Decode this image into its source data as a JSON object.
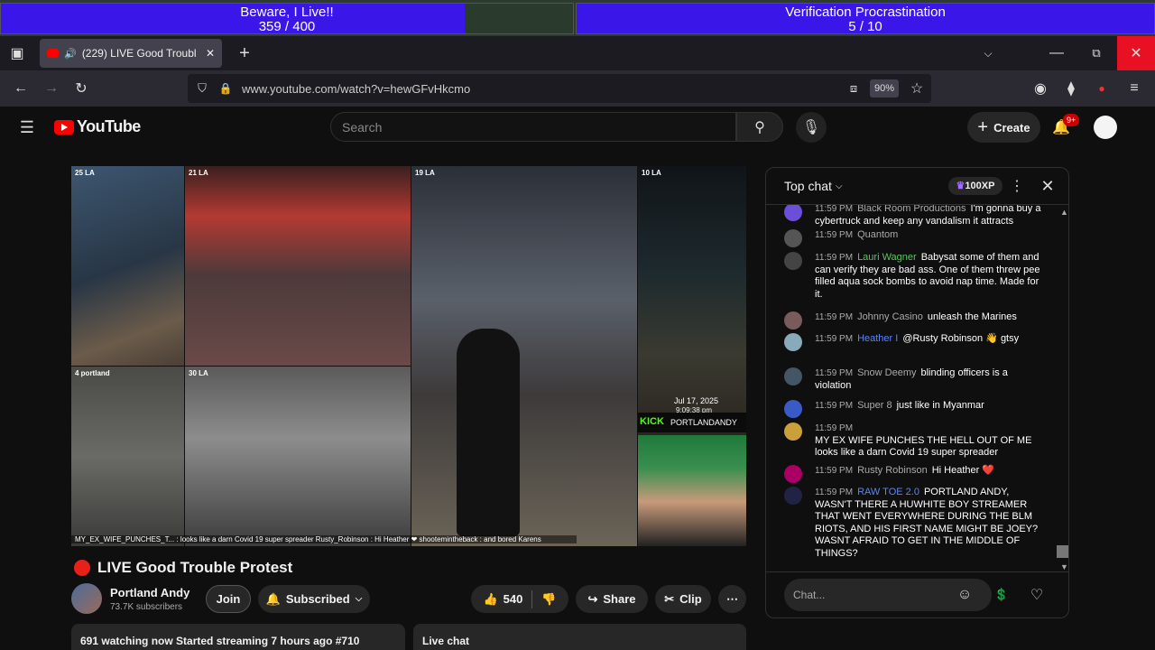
{
  "overlay": {
    "goal1": {
      "title": "Beware, I Live!!",
      "count": "359  / 400",
      "progress": 0.9
    },
    "goal2": {
      "title": "Verification Procrastination",
      "count": "5 / 10",
      "progress": 0.5
    }
  },
  "browser": {
    "tab": {
      "title": "(229)  LIVE Good Troubl"
    },
    "url": "www.youtube.com/watch?v=hewGFvHkcmo",
    "zoom": "90%"
  },
  "yt": {
    "logo": "YouTube",
    "search_placeholder": "Search",
    "create": "Create",
    "notif_count": "9+"
  },
  "video": {
    "tiles": [
      {
        "tag": "25 LA"
      },
      {
        "tag": "21 LA"
      },
      {
        "tag": "19 LA"
      },
      {
        "tag": "10 LA"
      },
      {
        "tag": "4 portland"
      },
      {
        "tag": "30 LA"
      }
    ],
    "timestamp_date": "Jul 17, 2025",
    "timestamp_time": "9:09:38 pm",
    "kick_label": "KICK",
    "kick_channel": "PORTLANDANDY",
    "ticker": "MY_EX_WIFE_PUNCHES_T... : looks like a darn Covid 19 super spreader   Rusty_Robinson : Hi Heather ❤   shootemintheback : and bored Karens"
  },
  "meta": {
    "title": "LIVE Good Trouble Protest",
    "channel": "Portland Andy",
    "subscribers": "73.7K subscribers",
    "join": "Join",
    "subscribed": "Subscribed",
    "likes": "540",
    "share": "Share",
    "clip": "Clip",
    "watching": "691",
    "watching_text": "watching now  Started streaming 7 hours ago  #710",
    "live_chat": "Live chat"
  },
  "chat": {
    "header": "Top chat",
    "xp": "100XP",
    "input_placeholder": "Chat...",
    "messages": [
      {
        "time": "11:59 PM",
        "author": "Black Room Productions",
        "text": "I'm gonna buy a cybertruck and keep any vandalism it attracts",
        "color": "#6b4fd8"
      },
      {
        "time": "11:59 PM",
        "author": "Quantom",
        "text": "",
        "color": "#555"
      },
      {
        "time": "11:59 PM",
        "author": "Lauri Wagner",
        "text": "Babysat some of them and can verify they are bad ass. One of them threw pee filled aqua sock bombs to avoid nap time. Made for it.",
        "color": "#444"
      },
      {
        "time": "11:59 PM",
        "author": "Johnny Casino",
        "text": "unleash the Marines",
        "color": "#7a5b5b"
      },
      {
        "time": "11:59 PM",
        "author": "Heather I",
        "text": "@Rusty Robinson 👋 gtsy",
        "color": "#8ab"
      },
      {
        "time": "11:59 PM",
        "author": "Snow Deemy",
        "text": "blinding officers is a violation",
        "color": "#456"
      },
      {
        "time": "11:59 PM",
        "author": "Super 8",
        "text": "just like in Myanmar",
        "color": "#3a5bc7"
      },
      {
        "time": "11:59 PM",
        "author": "",
        "text": "MY EX WIFE PUNCHES THE HELL OUT OF ME looks like a darn Covid 19 super spreader",
        "color": "#c9a03a"
      },
      {
        "time": "11:59 PM",
        "author": "Rusty Robinson",
        "text": "Hi Heather ❤️",
        "color": "#a06"
      },
      {
        "time": "11:59 PM",
        "author": "RAW TOE 2.0",
        "text": "PORTLAND ANDY, WASN'T THERE A HUWHITE BOY STREAMER THAT WENT EVERYWHERE DURING THE BLM RIOTS, AND HIS FIRST NAME MIGHT BE JOEY? WASNT AFRAID TO GET IN THE MIDDLE OF THINGS?",
        "color": "#224"
      }
    ]
  }
}
